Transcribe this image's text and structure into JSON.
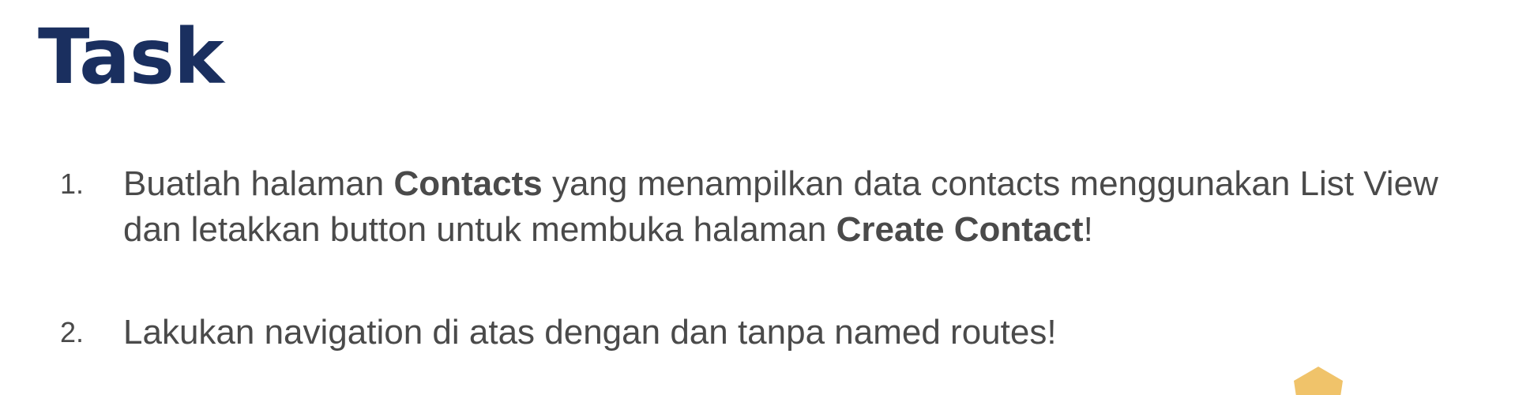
{
  "slide": {
    "title": "Task",
    "items": [
      {
        "number": "1.",
        "parts": [
          "Buatlah halaman ",
          "Contacts",
          " yang menampilkan data contacts menggunakan List View dan letakkan button untuk membuka halaman ",
          "Create Contact",
          "!"
        ]
      },
      {
        "number": "2.",
        "parts": [
          "Lakukan navigation di atas dengan dan tanpa named routes!"
        ]
      }
    ]
  },
  "colors": {
    "title": "#1a2f5f",
    "body_text": "#4a4a4a",
    "accent_shape": "#f0c36a"
  }
}
